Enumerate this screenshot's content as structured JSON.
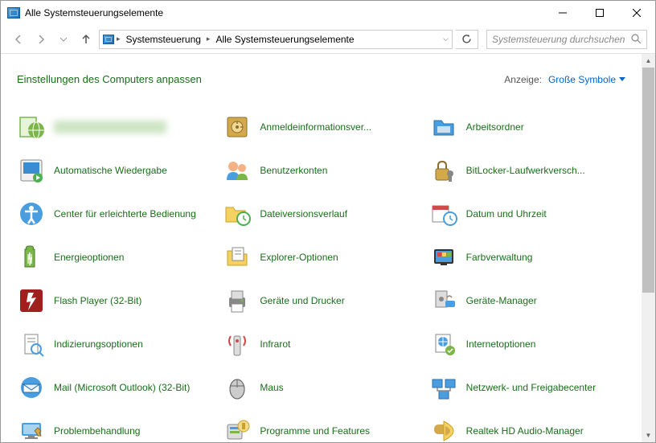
{
  "window": {
    "title": "Alle Systemsteuerungselemente"
  },
  "breadcrumb": {
    "root": "Systemsteuerung",
    "current": "Alle Systemsteuerungselemente"
  },
  "search": {
    "placeholder": "Systemsteuerung durchsuchen"
  },
  "header": {
    "title": "Einstellungen des Computers anpassen",
    "view_label": "Anzeige:",
    "view_value": "Große Symbole"
  },
  "items": [
    {
      "label": "████████████",
      "icon": "green-globe",
      "blurred": true
    },
    {
      "label": "Anmeldeinformationsver...",
      "icon": "safe"
    },
    {
      "label": "Arbeitsordner",
      "icon": "folder-blue"
    },
    {
      "label": "Automatische Wiedergabe",
      "icon": "media-square"
    },
    {
      "label": "Benutzerkonten",
      "icon": "users"
    },
    {
      "label": "BitLocker-Laufwerkversch...",
      "icon": "lock-key"
    },
    {
      "label": "Center für erleichterte Bedienung",
      "icon": "ease-access"
    },
    {
      "label": "Dateiversionsverlauf",
      "icon": "folder-clock"
    },
    {
      "label": "Datum und Uhrzeit",
      "icon": "calendar-clock"
    },
    {
      "label": "Energieoptionen",
      "icon": "battery"
    },
    {
      "label": "Explorer-Optionen",
      "icon": "folder-props"
    },
    {
      "label": "Farbverwaltung",
      "icon": "color-mgmt"
    },
    {
      "label": "Flash Player (32-Bit)",
      "icon": "flash"
    },
    {
      "label": "Geräte und Drucker",
      "icon": "printer"
    },
    {
      "label": "Geräte-Manager",
      "icon": "device-mgr"
    },
    {
      "label": "Indizierungsoptionen",
      "icon": "index"
    },
    {
      "label": "Infrarot",
      "icon": "infrared"
    },
    {
      "label": "Internetoptionen",
      "icon": "internet"
    },
    {
      "label": "Mail (Microsoft Outlook) (32-Bit)",
      "icon": "mail"
    },
    {
      "label": "Maus",
      "icon": "mouse"
    },
    {
      "label": "Netzwerk- und Freigabecenter",
      "icon": "network"
    },
    {
      "label": "Problembehandlung",
      "icon": "troubleshoot"
    },
    {
      "label": "Programme und Features",
      "icon": "programs"
    },
    {
      "label": "Realtek HD Audio-Manager",
      "icon": "realtek"
    }
  ]
}
